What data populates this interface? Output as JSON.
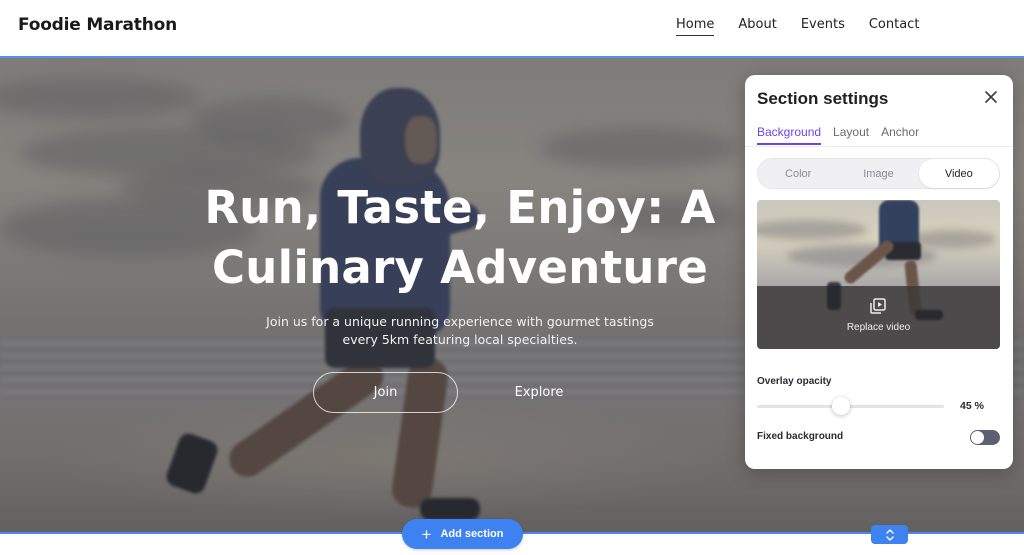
{
  "header": {
    "brand": "Foodie Marathon",
    "nav": [
      {
        "label": "Home",
        "active": true
      },
      {
        "label": "About",
        "active": false
      },
      {
        "label": "Events",
        "active": false
      },
      {
        "label": "Contact",
        "active": false
      }
    ]
  },
  "hero": {
    "title_line1": "Run, Taste, Enjoy: A",
    "title_line2": "Culinary Adventure",
    "subtitle_line1": "Join us for a unique running experience with gourmet tastings",
    "subtitle_line2": "every 5km featuring local specialties.",
    "primary_button": "Join",
    "secondary_button": "Explore"
  },
  "editor": {
    "add_section_label": "Add section",
    "add_section_icon": "plus-icon",
    "reorder_icon": "chevron-up-down-icon",
    "accent_color": "#3d82f0"
  },
  "panel": {
    "title": "Section settings",
    "close_icon": "close-icon",
    "tabs": [
      {
        "label": "Background",
        "active": true
      },
      {
        "label": "Layout",
        "active": false
      },
      {
        "label": "Anchor",
        "active": false
      }
    ],
    "tab_accent_color": "#6b47e0",
    "background_types": [
      {
        "label": "Color",
        "active": false
      },
      {
        "label": "Image",
        "active": false
      },
      {
        "label": "Video",
        "active": true
      }
    ],
    "preview": {
      "replace_label": "Replace video",
      "icon": "video-library-icon"
    },
    "overlay_opacity": {
      "label": "Overlay opacity",
      "value": 45,
      "value_text": "45 %"
    },
    "fixed_background": {
      "label": "Fixed background",
      "enabled": false
    }
  }
}
